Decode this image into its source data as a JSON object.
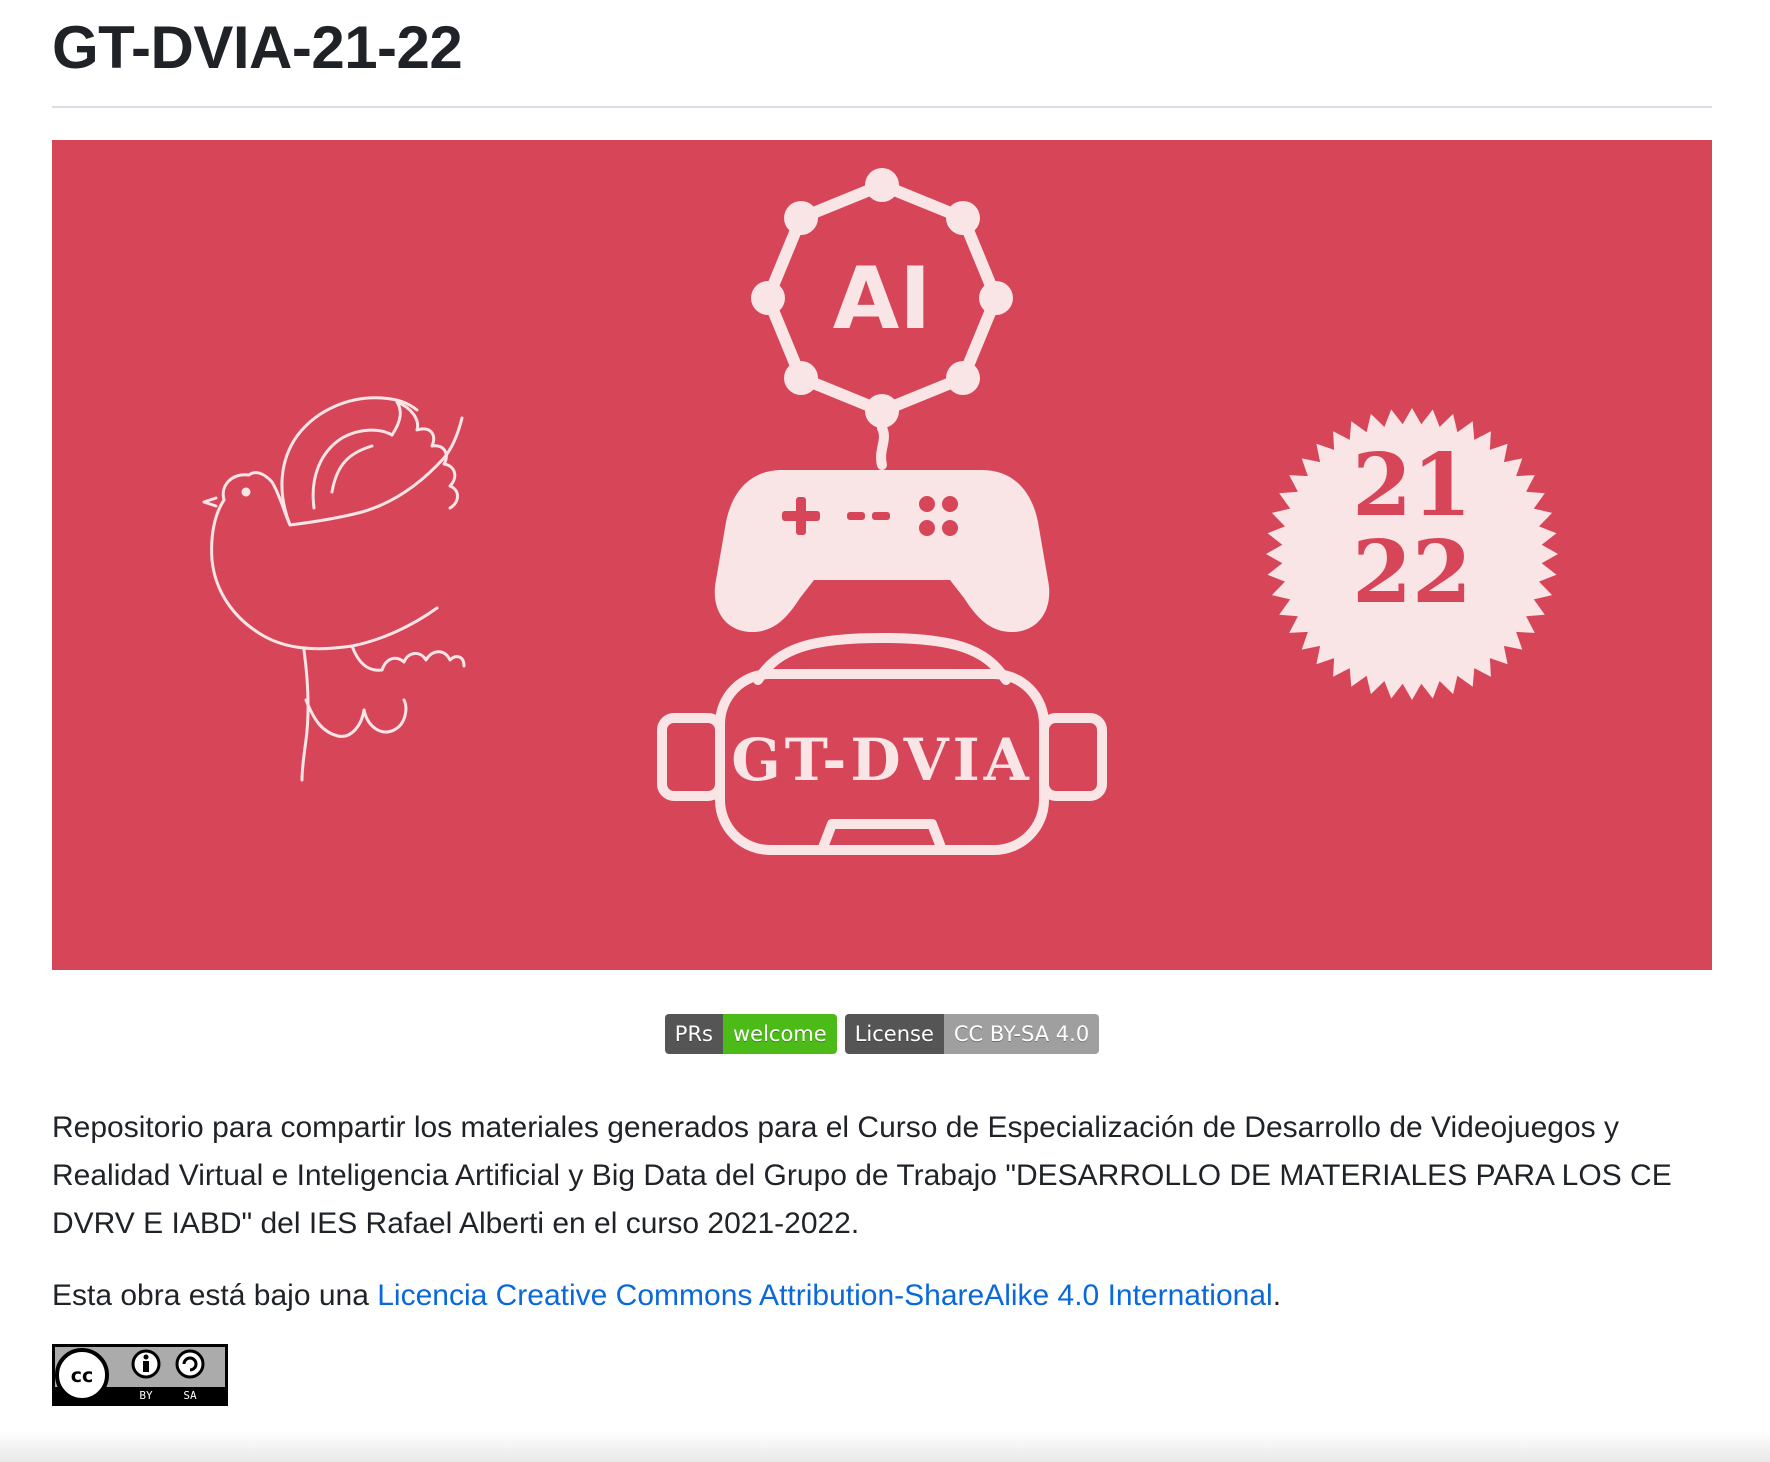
{
  "readme": {
    "title": "GT-DVIA-21-22"
  },
  "banner": {
    "background_color": "#d64658",
    "ink_color": "#f9e4e6",
    "ai_text": "AI",
    "logo_text": "GT-DVIA",
    "year_top": "21",
    "year_bottom": "22",
    "icons": [
      "dove-icon",
      "ai-network-icon",
      "gamepad-icon",
      "vr-headset-icon",
      "seal-badge-icon"
    ]
  },
  "badges": [
    {
      "label": "PRs",
      "message": "welcome",
      "color": "#4cbb17"
    },
    {
      "label": "License",
      "message": "CC BY-SA 4.0",
      "color": "#9f9f9f"
    }
  ],
  "description": "Repositorio para compartir los materiales generados para el Curso de Especialización de Desarrollo de Videojuegos y Realidad Virtual e Inteligencia Artificial y Big Data del Grupo de Trabajo \"DESARROLLO DE MATERIALES PARA LOS CE DVRV E IABD\" del IES Rafael Alberti en el curso 2021-2022.",
  "license": {
    "prefix": "Esta obra está bajo una ",
    "link_text": "Licencia Creative Commons Attribution-ShareAlike 4.0 International",
    "suffix": ".",
    "cc_badge": {
      "by_text": "BY",
      "sa_text": "SA"
    }
  }
}
